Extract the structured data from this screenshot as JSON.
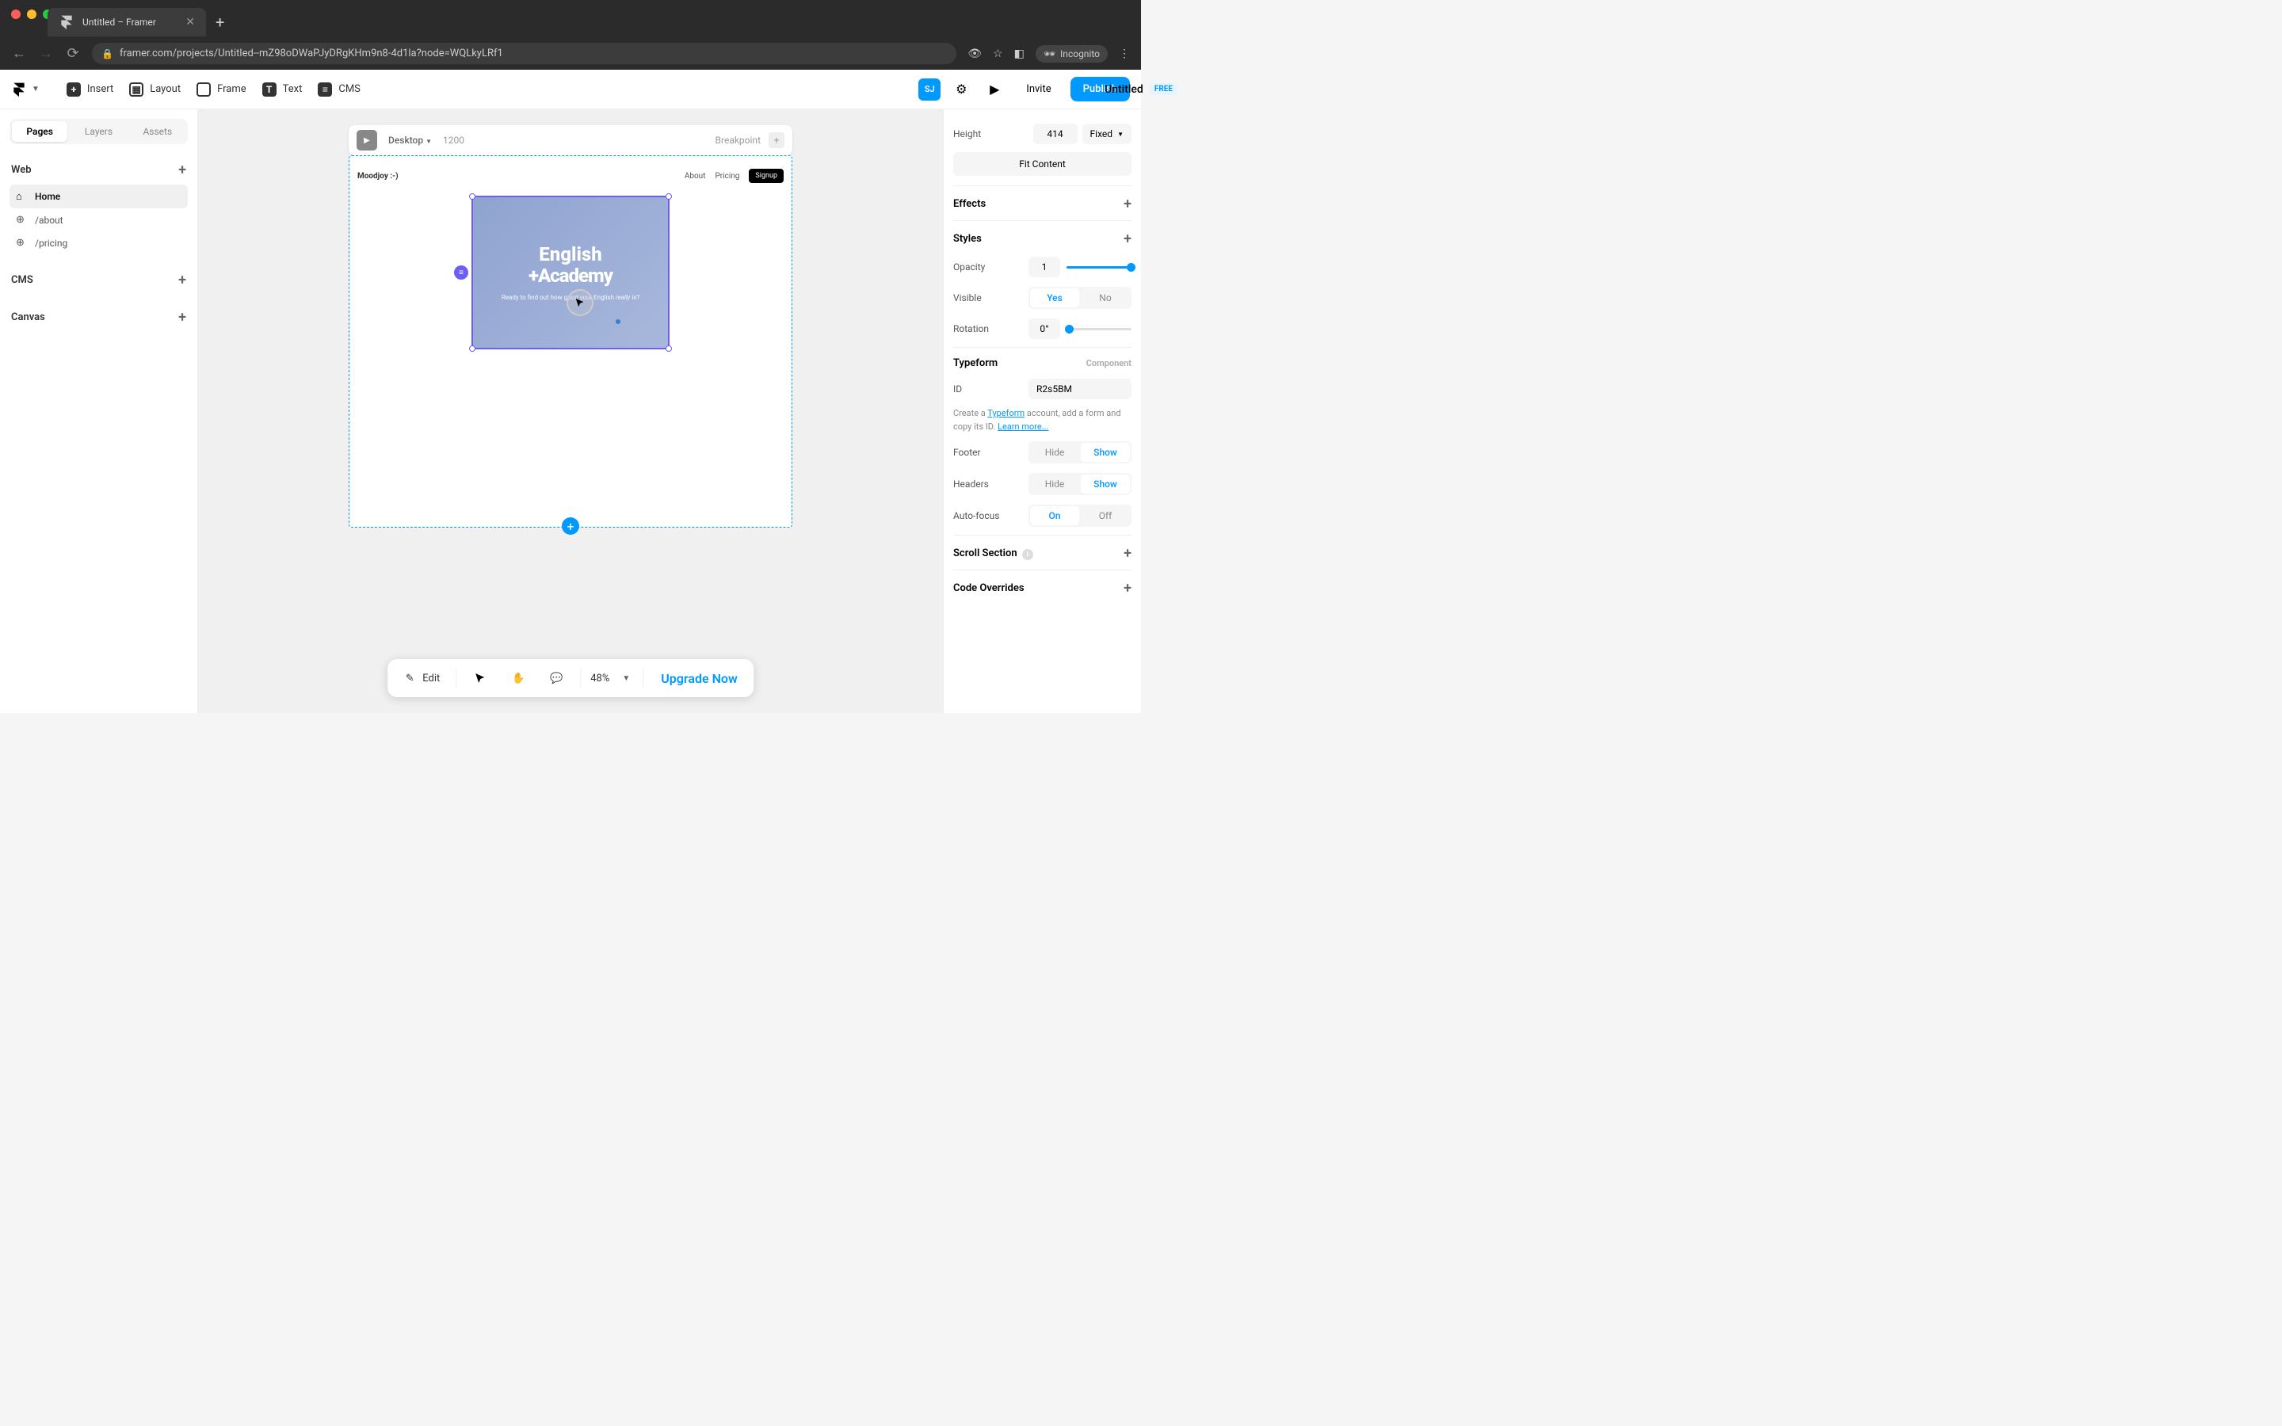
{
  "browser": {
    "tab_title": "Untitled – Framer",
    "url": "framer.com/projects/Untitled--mZ98oDWaPJyDRgKHm9n8-4d1la?node=WQLkyLRf1",
    "incognito": "Incognito"
  },
  "toolbar": {
    "insert": "Insert",
    "layout": "Layout",
    "frame": "Frame",
    "text": "Text",
    "cms": "CMS",
    "title": "Untitled",
    "free": "FREE",
    "avatar": "SJ",
    "invite": "Invite",
    "publish": "Publish"
  },
  "left": {
    "tabs": [
      "Pages",
      "Layers",
      "Assets"
    ],
    "web": "Web",
    "pages": [
      {
        "label": "Home",
        "icon": "home",
        "active": true
      },
      {
        "label": "/about",
        "icon": "globe",
        "active": false
      },
      {
        "label": "/pricing",
        "icon": "globe",
        "active": false
      }
    ],
    "cms": "CMS",
    "canvas": "Canvas"
  },
  "viewport": {
    "device": "Desktop",
    "width": "1200",
    "breakpoint": "Breakpoint"
  },
  "page": {
    "logo": "Moodjoy :-)",
    "nav": [
      "About",
      "Pricing"
    ],
    "signup": "Signup",
    "tf_title1": "English",
    "tf_title2": "Academy",
    "tf_sub_pre": "Ready to find out how good your English ",
    "tf_sub_em": "really",
    "tf_sub_post": " is?"
  },
  "bottom": {
    "edit": "Edit",
    "zoom": "48%",
    "upgrade": "Upgrade Now"
  },
  "right": {
    "height_label": "Height",
    "height_val": "414",
    "height_mode": "Fixed",
    "fit": "Fit Content",
    "effects": "Effects",
    "styles": "Styles",
    "opacity_label": "Opacity",
    "opacity_val": "1",
    "visible_label": "Visible",
    "visible_yes": "Yes",
    "visible_no": "No",
    "rotation_label": "Rotation",
    "rotation_val": "0°",
    "typeform": "Typeform",
    "component": "Component",
    "id_label": "ID",
    "id_val": "R2s5BM",
    "help_pre": "Create a ",
    "help_link1": "Typeform",
    "help_mid": " account, add a form and copy its ID. ",
    "help_link2": "Learn more...",
    "footer_label": "Footer",
    "headers_label": "Headers",
    "hide": "Hide",
    "show": "Show",
    "autofocus_label": "Auto-focus",
    "on": "On",
    "off": "Off",
    "scroll": "Scroll Section",
    "code": "Code Overrides"
  }
}
